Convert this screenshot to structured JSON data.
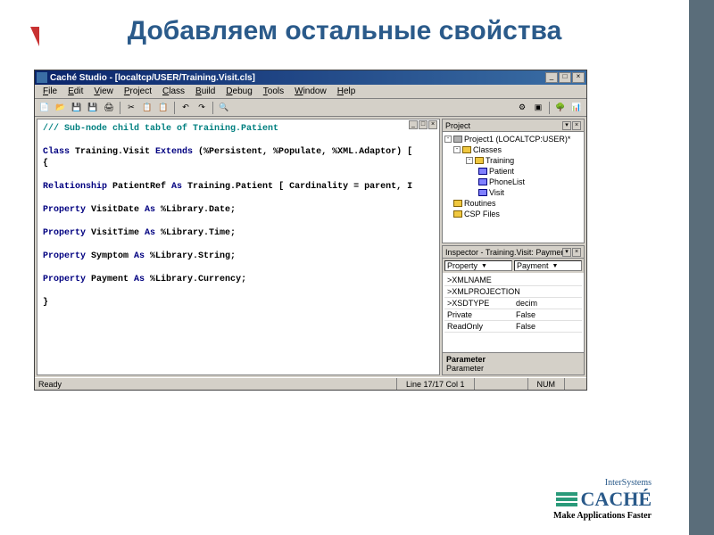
{
  "slide": {
    "title": "Добавляем остальные свойства"
  },
  "window": {
    "title": "Caché Studio - [localtcp/USER/Training.Visit.cls]",
    "menus": [
      "File",
      "Edit",
      "View",
      "Project",
      "Class",
      "Build",
      "Debug",
      "Tools",
      "Window",
      "Help"
    ]
  },
  "code": {
    "comment": "/// Sub-node child table of Training.Patient",
    "classline_a": "Class ",
    "classline_b": "Training.Visit ",
    "classline_c": "Extends ",
    "classline_d": "(%Persistent, %Populate, %XML.Adaptor) [",
    "brace_open": "{",
    "rel_a": "Relationship ",
    "rel_b": "PatientRef ",
    "rel_c": "As ",
    "rel_d": "Training.Patient [ Cardinality = parent, I",
    "p1_a": "Property ",
    "p1_b": "VisitDate ",
    "p1_c": "As ",
    "p1_d": "%Library.Date;",
    "p2_a": "Property ",
    "p2_b": "VisitTime ",
    "p2_c": "As ",
    "p2_d": "%Library.Time;",
    "p3_a": "Property ",
    "p3_b": "Symptom ",
    "p3_c": "As ",
    "p3_d": "%Library.String;",
    "p4_a": "Property ",
    "p4_b": "Payment ",
    "p4_c": "As ",
    "p4_d": "%Library.Currency;",
    "brace_close": "}"
  },
  "project": {
    "title": "Project",
    "root": "Project1 (LOCALTCP:USER)*",
    "folders": {
      "classes": "Classes",
      "training": "Training",
      "items": [
        "Patient",
        "PhoneList",
        "Visit"
      ],
      "routines": "Routines",
      "csp": "CSP Files"
    }
  },
  "inspector": {
    "title": "Inspector - Training.Visit: Paymen",
    "col1": "Property",
    "col2": "Payment",
    "rows": [
      {
        "n": ">XMLNAME",
        "v": ""
      },
      {
        "n": ">XMLPROJECTION",
        "v": ""
      },
      {
        "n": ">XSDTYPE",
        "v": "decim"
      },
      {
        "n": "Private",
        "v": "False"
      },
      {
        "n": "ReadOnly",
        "v": "False"
      }
    ],
    "help_t": "Parameter",
    "help_b": "Parameter"
  },
  "status": {
    "ready": "Ready",
    "pos": "Line 17/17 Col 1",
    "num": "NUM"
  },
  "logo": {
    "inter": "InterSystems",
    "name": "CACHÉ",
    "tag": "Make Applications Faster"
  }
}
